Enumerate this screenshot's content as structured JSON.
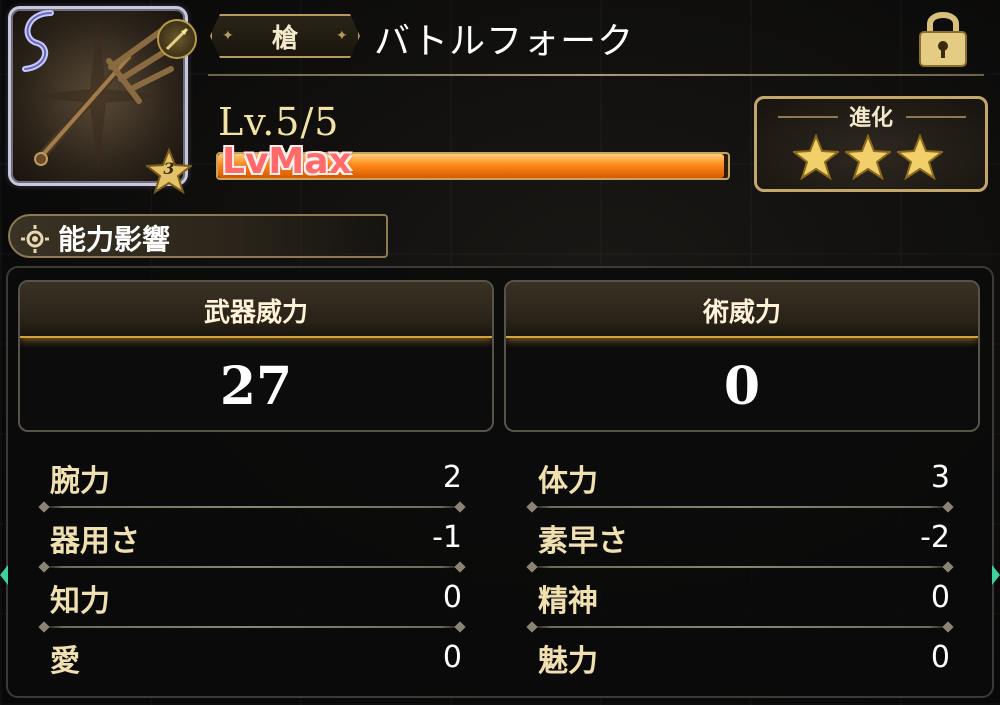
{
  "weapon": {
    "type_label": "槍",
    "name": "バトルフォーク",
    "rarity": "3",
    "level_text": "Lv.5/5",
    "level_current": 5,
    "level_max": 5,
    "level_status": "LvMax"
  },
  "evolution": {
    "label": "進化",
    "stars_filled": 3,
    "stars_total": 3
  },
  "section": {
    "title": "能力影響"
  },
  "power": [
    {
      "label": "武器威力",
      "value": "27"
    },
    {
      "label": "術威力",
      "value": "0"
    }
  ],
  "stats_left": [
    {
      "label": "腕力",
      "value": "2"
    },
    {
      "label": "器用さ",
      "value": "-1"
    },
    {
      "label": "知力",
      "value": "0"
    },
    {
      "label": "愛",
      "value": "0"
    }
  ],
  "stats_right": [
    {
      "label": "体力",
      "value": "3"
    },
    {
      "label": "素早さ",
      "value": "-2"
    },
    {
      "label": "精神",
      "value": "0"
    },
    {
      "label": "魅力",
      "value": "0"
    }
  ],
  "colors": {
    "gold": "#c3a66a",
    "bar_fill": "#ff8a1a",
    "lvmax": "#ff6a6a"
  }
}
